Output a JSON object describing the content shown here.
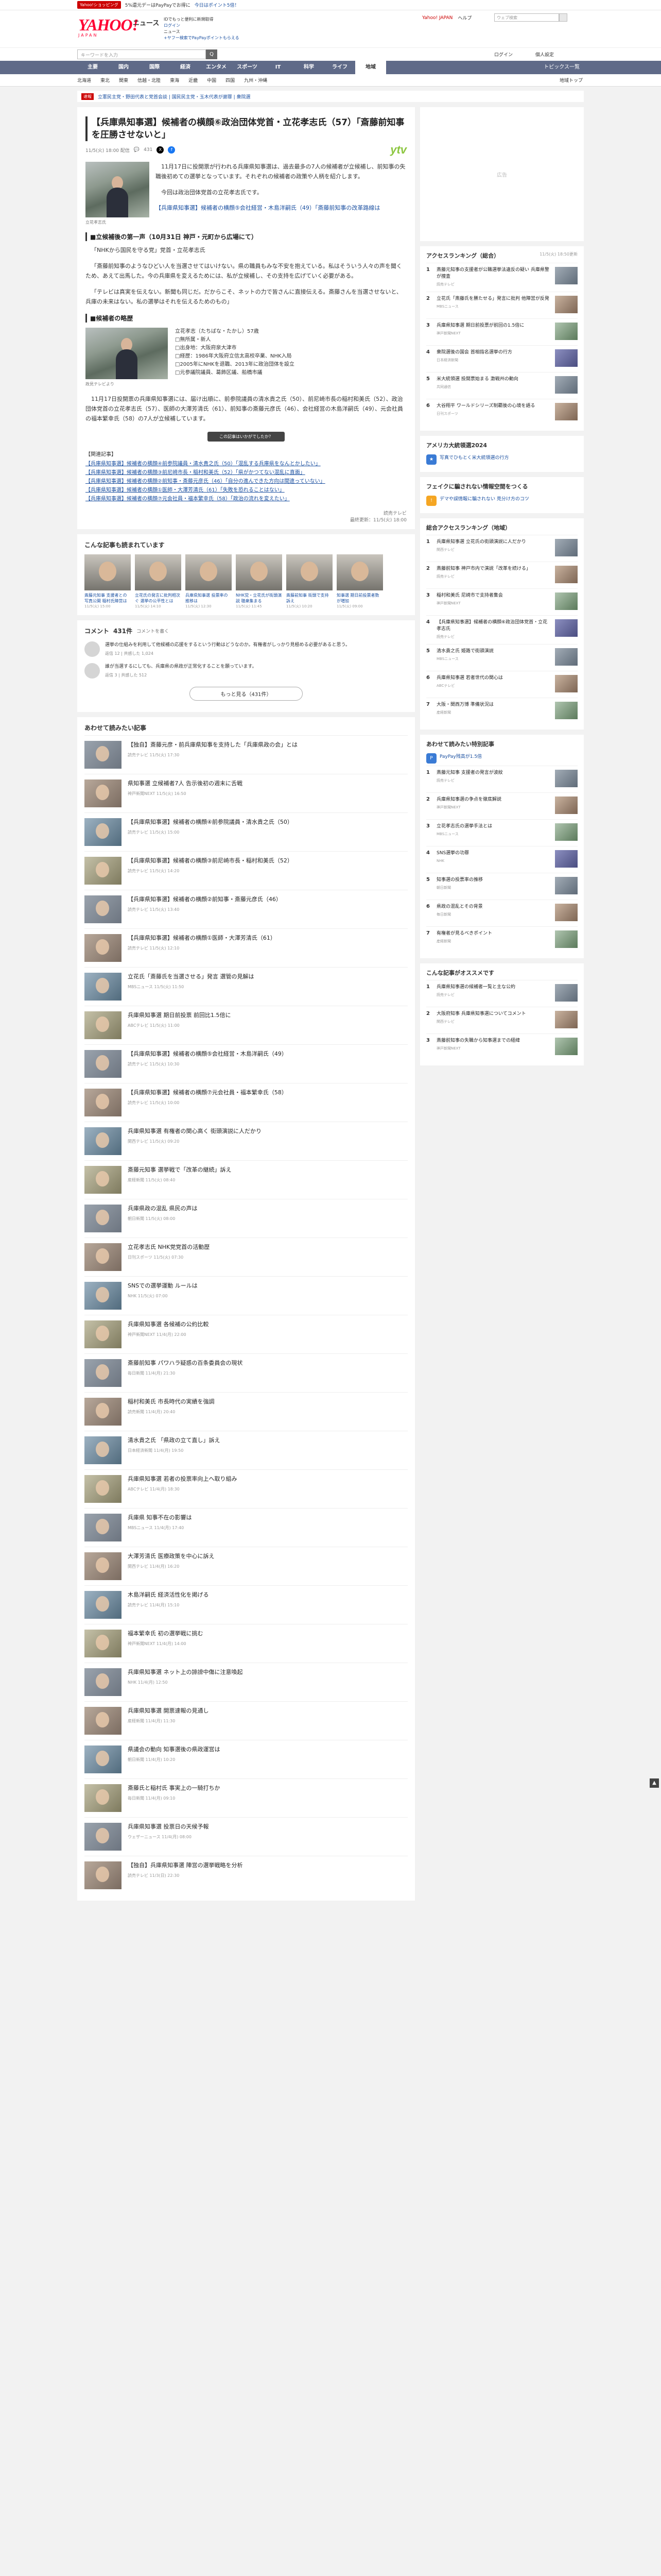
{
  "topbar": {
    "promo_button": "Yahoo!ショッピング",
    "promo_text": "5%還元デーはPayPayでお得に",
    "promo_text2": "今日はポイント5倍！"
  },
  "header": {
    "logo": "YAHOO!",
    "logo_jp": "JAPAN",
    "section_label": "ニュース",
    "links_line1": "IDでもっと便利に新規取得",
    "links_line2": "ログイン",
    "links_line3": "ニュース",
    "links_line4": "+ヤフー検索でPayPayポイントもらえる",
    "right_links": [
      "Yahoo! JAPAN",
      "ヘルプ",
      "検索"
    ],
    "search_placeholder": "ウェブ検索"
  },
  "searchrow": {
    "keyword_placeholder": "キーワードを入力",
    "search_button": "Q",
    "right1": "ログイン",
    "right2": "個人設定"
  },
  "catnav": {
    "items": [
      "主要",
      "国内",
      "国際",
      "経済",
      "エンタメ",
      "スポーツ",
      "IT",
      "科学",
      "ライフ",
      "地域"
    ],
    "active_index": 9,
    "topics_label": "トピックス一覧"
  },
  "subnav": {
    "items": [
      "北海道",
      "東北",
      "関東",
      "信越・北陸",
      "東海",
      "近畿",
      "中国",
      "四国",
      "九州・沖縄"
    ],
    "right": "地域トップ"
  },
  "trendbar": {
    "tag": "速報",
    "links": "立憲民主党・野田代表と党首会談 | 国民民主党・玉木代表が謝罪 | 衆院選"
  },
  "article": {
    "title": "【兵庫県知事選】候補者の横顔⑥政治団体党首・立花孝志氏（57）「斎藤前知事を圧勝させないと」",
    "date": "11/5(火) 18:00 配信",
    "comment_count": "431",
    "source_logo": "ytv",
    "photo_caption": "立花孝志氏",
    "lead_paragraphs": [
      "11月17日に投開票が行われる兵庫県知事選は、過去最多の7人の候補者が立候補し、前知事の失職後初めての選挙となっています。それぞれの候補者の政策や人柄を紹介します。",
      "今回は政治団体党首の立花孝志氏です。"
    ],
    "inline_link": "【兵庫県知事選】候補者の横顔⑤会社経営・木島洋嗣氏（49）「斎藤前知事の改革路線は",
    "h2_1": "■立候補後の第一声（10月31日 神戸・元町から広場にて）",
    "paragraphs": [
      "「NHKから国民を守る党」党首・立花孝志氏",
      "「斎藤前知事のようなひどい人を当選させてはいけない。県の職員もみな不安を抱えている。私はそういう人々の声を聞くため、あえて出馬した。今の兵庫県を変えるためには、私が立候補し、その支持を広げていく必要がある。",
      "「テレビは真実を伝えない。新聞も同じだ。だからこそ、ネットの力で皆さんに直接伝える。斎藤さんを当選させないと、兵庫の未来はない。私の選挙はそれを伝えるためのもの」"
    ],
    "h2_2": "■候補者の略歴",
    "profile_caption": "政見テレビより",
    "profile_lines": [
      "立花孝志（たちばな・たかし）57歳",
      "□無所属・新人",
      "□出身地：大阪府泉大津市",
      "□経歴：1986年大阪府立信太高校卒業、NHK入局",
      "□2005年にNHKを退職、2013年に政治団体を設立",
      "□元参議院議員、葛飾区議、船橋市議"
    ],
    "closing": "11月17日投開票の兵庫県知事選には、届け出順に、前参院議員の清水貴之氏（50）、前尼崎市長の稲村和美氏（52）、政治団体党首の立花孝志氏（57）、医師の大澤芳清氏（61）、前知事の斎藤元彦氏（46）、会社経営の木島洋嗣氏（49）、元会社員の福本繁幸氏（58）の7人が立候補しています。",
    "related_heading": "【関連記事】",
    "related_links": [
      "【兵庫県知事選】候補者の横顔④前参院議員・清水貴之氏（50）「混乱する兵庫県をなんとかしたい」",
      "【兵庫県知事選】候補者の横顔③前尼崎市長・稲村和美氏（52）「県がかつてない混乱に直面」",
      "【兵庫県知事選】候補者の横顔②前知事・斎藤元彦氏（46）「自分の進んできた方向は間違っていない」",
      "【兵庫県知事選】候補者の横顔①医師・大澤芳清氏（61）「失敗を恐れることはない」",
      "【兵庫県知事選】候補者の横顔⑦元会社員・福本繁幸氏（58）「政治の流れを変えたい」"
    ],
    "footer": "読売テレビ",
    "footer_time": "最終更新：11/5(火) 18:00",
    "ad_note": "この記事はいかがでしたか？"
  },
  "people": {
    "heading": "こんな記事も読まれています",
    "cards": [
      {
        "text": "斎藤元知事 支援者との写真公開 稲村氏陣営は",
        "time": "11/5(火) 15:00"
      },
      {
        "text": "立花氏の発言に批判相次ぐ 選挙の公平性とは",
        "time": "11/5(火) 14:10"
      },
      {
        "text": "兵庫県知事選 投票率の推移は",
        "time": "11/5(火) 12:30"
      },
      {
        "text": "NHK党・立花氏が街頭演説 聴衆集まる",
        "time": "11/5(火) 11:45"
      },
      {
        "text": "斎藤前知事 街頭で支持訴え",
        "time": "11/5(火) 10:20"
      },
      {
        "text": "知事選 期日前投票者数が増加",
        "time": "11/5(火) 09:00"
      }
    ]
  },
  "comments": {
    "heading": "コメント",
    "count": "431件",
    "sub": "コメントを書く",
    "items": [
      {
        "body": "選挙の仕組みを利用して他候補の応援をするという行動はどうなのか。有権者がしっかり見極める必要があると思う。",
        "footer": "返信 12 | 共感した 1,024"
      },
      {
        "body": "誰が当選するにしても、兵庫県の県政が正常化することを願っています。",
        "footer": "返信 3 | 共感した 512"
      }
    ],
    "more_button": "もっと見る（431件）"
  },
  "newslist": {
    "heading": "あわせて読みたい記事",
    "items": [
      {
        "title": "【独自】斎藤元彦・前兵庫県知事を支持した「兵庫県政の会」とは",
        "src": "読売テレビ 11/5(火) 17:30"
      },
      {
        "title": "県知事選 立候補者7人 告示後初の週末に舌戦",
        "src": "神戸新聞NEXT 11/5(火) 16:50"
      },
      {
        "title": "【兵庫県知事選】候補者の横顔④前参院議員・清水貴之氏（50）",
        "src": "読売テレビ 11/5(火) 15:00"
      },
      {
        "title": "【兵庫県知事選】候補者の横顔③前尼崎市長・稲村和美氏（52）",
        "src": "読売テレビ 11/5(火) 14:20"
      },
      {
        "title": "【兵庫県知事選】候補者の横顔②前知事・斎藤元彦氏（46）",
        "src": "読売テレビ 11/5(火) 13:40"
      },
      {
        "title": "【兵庫県知事選】候補者の横顔①医師・大澤芳清氏（61）",
        "src": "読売テレビ 11/5(火) 12:10"
      },
      {
        "title": "立花氏「斎藤氏を当選させる」発言 選管の見解は",
        "src": "MBSニュース 11/5(火) 11:50"
      },
      {
        "title": "兵庫県知事選 期日前投票 前回比1.5倍に",
        "src": "ABCテレビ 11/5(火) 11:00"
      },
      {
        "title": "【兵庫県知事選】候補者の横顔⑤会社経営・木島洋嗣氏（49）",
        "src": "読売テレビ 11/5(火) 10:30"
      },
      {
        "title": "【兵庫県知事選】候補者の横顔⑦元会社員・福本繁幸氏（58）",
        "src": "読売テレビ 11/5(火) 10:00"
      },
      {
        "title": "兵庫県知事選 有権者の関心高く 街頭演説に人だかり",
        "src": "関西テレビ 11/5(火) 09:20"
      },
      {
        "title": "斎藤元知事 選挙戦で「改革の継続」訴え",
        "src": "産経新聞 11/5(火) 08:40"
      },
      {
        "title": "兵庫県政の混乱 県民の声は",
        "src": "朝日新聞 11/5(火) 08:00"
      },
      {
        "title": "立花孝志氏 NHK党党首の活動歴",
        "src": "日刊スポーツ 11/5(火) 07:30"
      },
      {
        "title": "SNSでの選挙運動 ルールは",
        "src": "NHK 11/5(火) 07:00"
      },
      {
        "title": "兵庫県知事選 各候補の公約比較",
        "src": "神戸新聞NEXT 11/4(月) 22:00"
      },
      {
        "title": "斎藤前知事 パワハラ疑惑の百条委員会の現状",
        "src": "毎日新聞 11/4(月) 21:30"
      },
      {
        "title": "稲村和美氏 市長時代の実績を強調",
        "src": "読売新聞 11/4(月) 20:40"
      },
      {
        "title": "清水貴之氏 「県政の立て直し」訴え",
        "src": "日本経済新聞 11/4(月) 19:50"
      },
      {
        "title": "兵庫県知事選 若者の投票率向上へ取り組み",
        "src": "ABCテレビ 11/4(月) 18:30"
      },
      {
        "title": "兵庫県 知事不在の影響は",
        "src": "MBSニュース 11/4(月) 17:40"
      },
      {
        "title": "大澤芳清氏 医療政策を中心に訴え",
        "src": "関西テレビ 11/4(月) 16:20"
      },
      {
        "title": "木島洋嗣氏 経済活性化を掲げる",
        "src": "読売テレビ 11/4(月) 15:10"
      },
      {
        "title": "福本繁幸氏 初の選挙戦に挑む",
        "src": "神戸新聞NEXT 11/4(月) 14:00"
      },
      {
        "title": "兵庫県知事選 ネット上の誹謗中傷に注意喚起",
        "src": "NHK 11/4(月) 12:50"
      },
      {
        "title": "兵庫県知事選 開票速報の見通し",
        "src": "産経新聞 11/4(月) 11:30"
      },
      {
        "title": "県議会の動向 知事選後の県政運営は",
        "src": "朝日新聞 11/4(月) 10:20"
      },
      {
        "title": "斎藤氏と稲村氏 事実上の一騎打ちか",
        "src": "毎日新聞 11/4(月) 09:10"
      },
      {
        "title": "兵庫県知事選 投票日の天候予報",
        "src": "ウェザーニュース 11/4(月) 08:00"
      },
      {
        "title": "【独自】兵庫県知事選 陣営の選挙戦略を分析",
        "src": "読売テレビ 11/3(日) 22:30"
      }
    ]
  },
  "sidebar": {
    "ad_label": "広告",
    "ranking_heading": "アクセスランキング（総合）",
    "ranking_sub": "11/5(火) 18:50更新",
    "ranking": [
      {
        "num": "1",
        "title": "斎藤元知事の支援者が公職選挙法違反の疑い 兵庫県警が捜査",
        "src": "読売テレビ"
      },
      {
        "num": "2",
        "title": "立花氏「斎藤氏を勝たせる」発言に批判 他陣営が反発",
        "src": "MBSニュース"
      },
      {
        "num": "3",
        "title": "兵庫県知事選 期日前投票が前回の1.5倍に",
        "src": "神戸新聞NEXT"
      },
      {
        "num": "4",
        "title": "衆院選後の国会 首相指名選挙の行方",
        "src": "日本経済新聞"
      },
      {
        "num": "5",
        "title": "米大統領選 投開票始まる 激戦州の動向",
        "src": "共同通信"
      },
      {
        "num": "6",
        "title": "大谷翔平 ワールドシリーズ制覇後の心境を語る",
        "src": "日刊スポーツ"
      }
    ],
    "special_heading": "アメリカ大統領選2024",
    "special_link": "写真でひもとく米大統領選の行方",
    "fact_heading": "フェイクに騙されない情報空間をつくる",
    "fact_link": "デマや誤情報に騙されない 見分け方のコツ",
    "local_heading": "総合アクセスランキング（地域）",
    "local_ranking": [
      {
        "num": "1",
        "title": "兵庫県知事選 立花氏の街頭演説に人だかり",
        "src": "関西テレビ"
      },
      {
        "num": "2",
        "title": "斎藤前知事 神戸市内で演説「改革を続ける」",
        "src": "読売テレビ"
      },
      {
        "num": "3",
        "title": "稲村和美氏 尼崎市で支持者集会",
        "src": "神戸新聞NEXT"
      },
      {
        "num": "4",
        "title": "【兵庫県知事選】候補者の横顔⑥政治団体党首・立花孝志氏",
        "src": "読売テレビ"
      },
      {
        "num": "5",
        "title": "清水貴之氏 姫路で街頭演説",
        "src": "MBSニュース"
      },
      {
        "num": "6",
        "title": "兵庫県知事選 若者世代の関心は",
        "src": "ABCテレビ"
      },
      {
        "num": "7",
        "title": "大阪・関西万博 準備状況は",
        "src": "産経新聞"
      }
    ],
    "paypay_heading": "あわせて読みたい特別記事",
    "paypay_sub": "PayPay残高が1.5倍",
    "feature_ranking": [
      {
        "num": "1",
        "title": "斎藤元知事 支援者の発言が波紋",
        "src": "読売テレビ"
      },
      {
        "num": "2",
        "title": "兵庫県知事選の争点を徹底解説",
        "src": "神戸新聞NEXT"
      },
      {
        "num": "3",
        "title": "立花孝志氏の選挙手法とは",
        "src": "MBSニュース"
      },
      {
        "num": "4",
        "title": "SNS選挙の功罪",
        "src": "NHK"
      },
      {
        "num": "5",
        "title": "知事選の投票率の推移",
        "src": "朝日新聞"
      },
      {
        "num": "6",
        "title": "県政の混乱とその背景",
        "src": "毎日新聞"
      },
      {
        "num": "7",
        "title": "有権者が見るべきポイント",
        "src": "産経新聞"
      }
    ],
    "recommend_heading": "こんな記事がオススメです",
    "recommend": [
      {
        "num": "1",
        "title": "兵庫県知事選の候補者一覧と主な公約",
        "src": "読売テレビ"
      },
      {
        "num": "2",
        "title": "大阪府知事 兵庫県知事選についてコメント",
        "src": "関西テレビ"
      },
      {
        "num": "3",
        "title": "斎藤前知事の失職から知事選までの経緯",
        "src": "神戸新聞NEXT"
      }
    ]
  },
  "pagetop": "▲"
}
